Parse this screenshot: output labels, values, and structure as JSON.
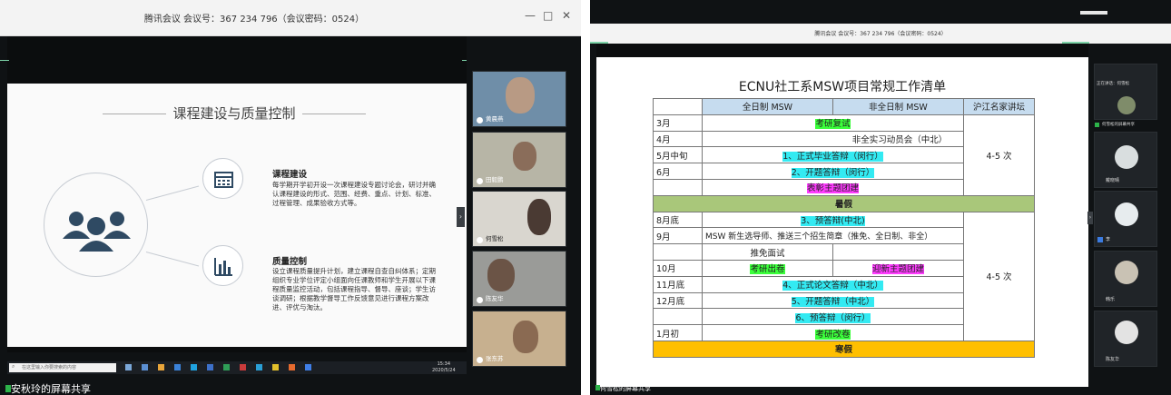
{
  "left": {
    "window_title": "腾讯会议 会议号：367 234 796（会议密码：0524）",
    "controls": {
      "minimize": "—",
      "maximize": "□",
      "close": "✕"
    },
    "slide": {
      "title": "课程建设与质量控制",
      "section1": {
        "title": "课程建设",
        "body": "每学期开学初开设一次课程建设专题讨论会，研讨并确认课程建设的形式、范围、经费、重点、计划、标准、过程管理、成果验收方式等。"
      },
      "section2": {
        "title": "质量控制",
        "body": "设立课程质量提升计划，建立课程自查自纠体系；定期组织专业学位评定小组面向任课教师和学生开展以下课程质量监控活动，包括课程指导、督导、座谈；学生访谈调研；根据教学督导工作反馈意见进行课程方案改进、评优与淘汰。"
      }
    },
    "participants": [
      "黄晨燕",
      "田毅鹏",
      "何雪松",
      "陈友华",
      "张东苏"
    ],
    "taskbar": {
      "search_placeholder": "在这里输入你要搜索的内容",
      "time": "15:34",
      "date": "2020/5/24"
    },
    "caption": "安秋玲的屏幕共享"
  },
  "right": {
    "window_title": "腾讯会议 会议号：367 234 796（会议密码：0524）",
    "doc": {
      "title": "ECNU社工系MSW项目常规工作清单",
      "headers": [
        "",
        "全日制 MSW",
        "非全日制 MSW",
        "沪江名家讲坛"
      ],
      "rows": {
        "r1": {
          "month": "3月",
          "text": "考研复试"
        },
        "r2": {
          "month": "4月",
          "text": "非全实习动员会（中北）"
        },
        "r3": {
          "month": "5月中旬",
          "text": "1、正式毕业答辩（闵行）"
        },
        "r4": {
          "month": "6月",
          "text": "2、开题答辩（闵行）"
        },
        "r5": {
          "month": "",
          "text": "表彰主题团建"
        },
        "r6": {
          "month": "",
          "text": "暑假"
        },
        "r7": {
          "month": "8月底",
          "text": "3、预答辩(中北)"
        },
        "r8": {
          "month": "9月",
          "text": "MSW 新生选导师、推送三个招生简章（推免、全日制、非全）"
        },
        "r9": {
          "month": "",
          "text": "推免面试"
        },
        "r10": {
          "month": "10月",
          "text_a": "考研出卷",
          "text_b": "迎新主题团建"
        },
        "r11": {
          "month": "11月底",
          "text": "4、正式论文答辩（中北）"
        },
        "r12": {
          "month": "12月底",
          "text": "5、开题答辩（中北）"
        },
        "r13": {
          "month": "",
          "text": "6、预答辩（闵行）"
        },
        "r14": {
          "month": "1月初",
          "text": "考研改卷"
        },
        "r15": {
          "month": "",
          "text": "寒假"
        }
      },
      "lecture_1": "4-5 次",
      "lecture_2": "4-5 次"
    },
    "participants": [
      "正在讲话：何雪松",
      "何雪松的屏幕共享",
      "戴晓晴",
      "李",
      "韩乐",
      "陈友华"
    ],
    "caption": "何雪松的屏幕共享"
  }
}
